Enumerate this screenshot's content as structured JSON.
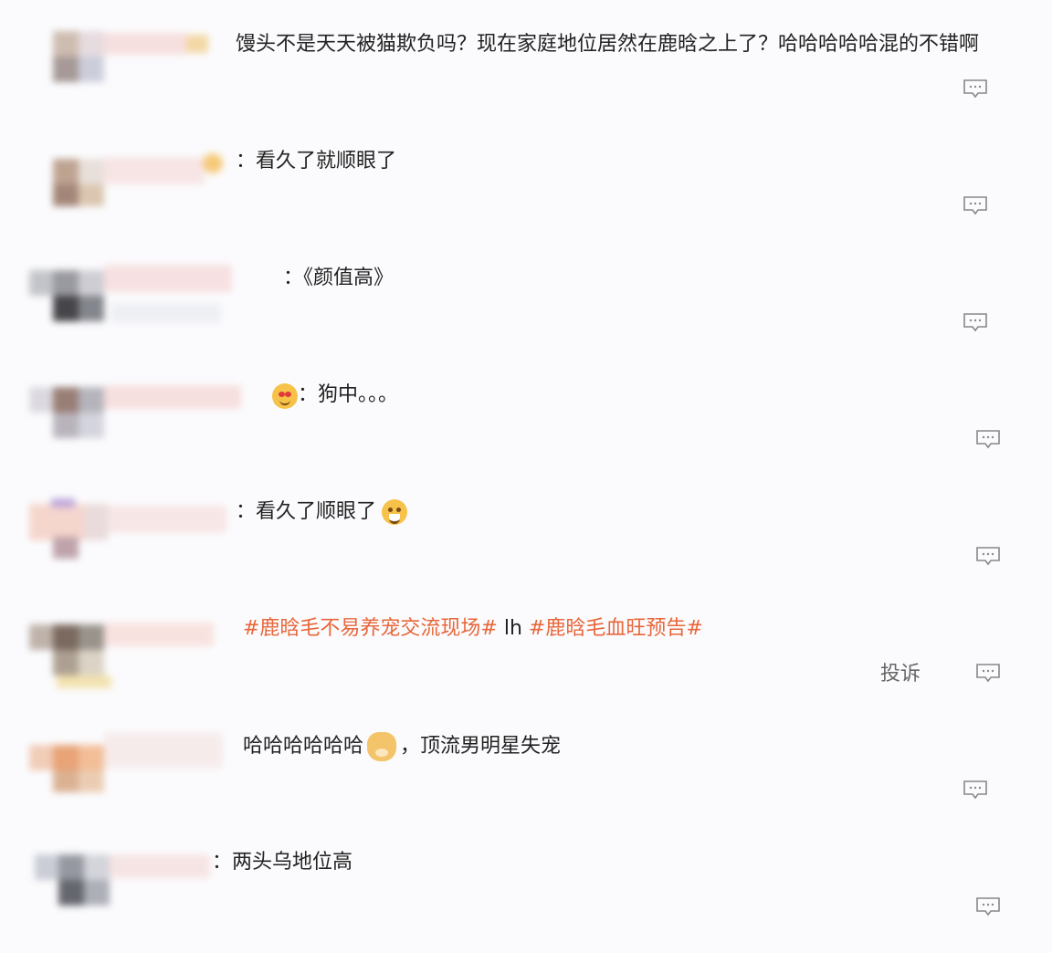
{
  "comments": [
    {
      "text": "馒头不是天天被猫欺负吗？现在家庭地位居然在鹿晗之上了？哈哈哈哈哈混的不错啊"
    },
    {
      "text": "：看久了就顺眼了"
    },
    {
      "text": "：《颜值高》"
    },
    {
      "text": "：狗中。。。"
    },
    {
      "text": "：看久了顺眼了"
    },
    {
      "hashtag1": "#鹿晗毛不易养宠交流现场#",
      "middle": " lh ",
      "hashtag2": "#鹿晗毛血旺预告#",
      "report": "投诉"
    },
    {
      "text_before": "哈哈哈哈哈哈",
      "text_after": "，顶流男明星失宠"
    },
    {
      "text": "：两头乌地位高"
    }
  ],
  "icons": {
    "reply": "comment-reply-icon",
    "emoji_heart": "heart-eyes-emoji-icon",
    "emoji_laugh": "laughing-emoji-icon",
    "emoji_dog": "doge-emoji-icon"
  },
  "colors": {
    "hashtag": "#e8663a",
    "text": "#222222",
    "icon": "#888888"
  }
}
